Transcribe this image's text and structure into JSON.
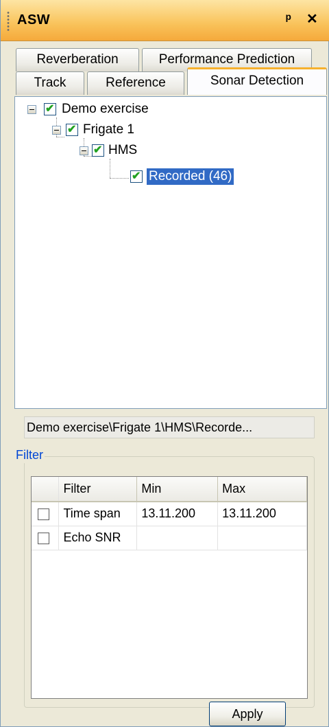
{
  "panel": {
    "title": "ASW",
    "pin_glyph": "ᵖ",
    "close_glyph": "✕"
  },
  "tabs": {
    "row1": [
      {
        "label": "Reverberation"
      },
      {
        "label": "Performance Prediction"
      }
    ],
    "row2": [
      {
        "label": "Track"
      },
      {
        "label": "Reference"
      },
      {
        "label": "Sonar Detection",
        "active": true
      }
    ]
  },
  "tree": {
    "nodes": [
      {
        "label": "Demo exercise",
        "checked": true,
        "expanded": true
      },
      {
        "label": "Frigate 1",
        "checked": true,
        "expanded": true
      },
      {
        "label": "HMS",
        "checked": true,
        "expanded": true
      },
      {
        "label": "Recorded (46)",
        "checked": true,
        "selected": true
      }
    ]
  },
  "path": {
    "text": "Demo exercise\\Frigate 1\\HMS\\Recorde..."
  },
  "filter": {
    "group_label": "Filter",
    "columns": [
      "Filter",
      "Min",
      "Max"
    ],
    "rows": [
      {
        "name": "Time span",
        "min": "13.11.200",
        "max": "13.11.200",
        "checked": false
      },
      {
        "name": "Echo SNR",
        "min": "",
        "max": "",
        "checked": false
      }
    ]
  },
  "actions": {
    "apply_label": "Apply"
  }
}
